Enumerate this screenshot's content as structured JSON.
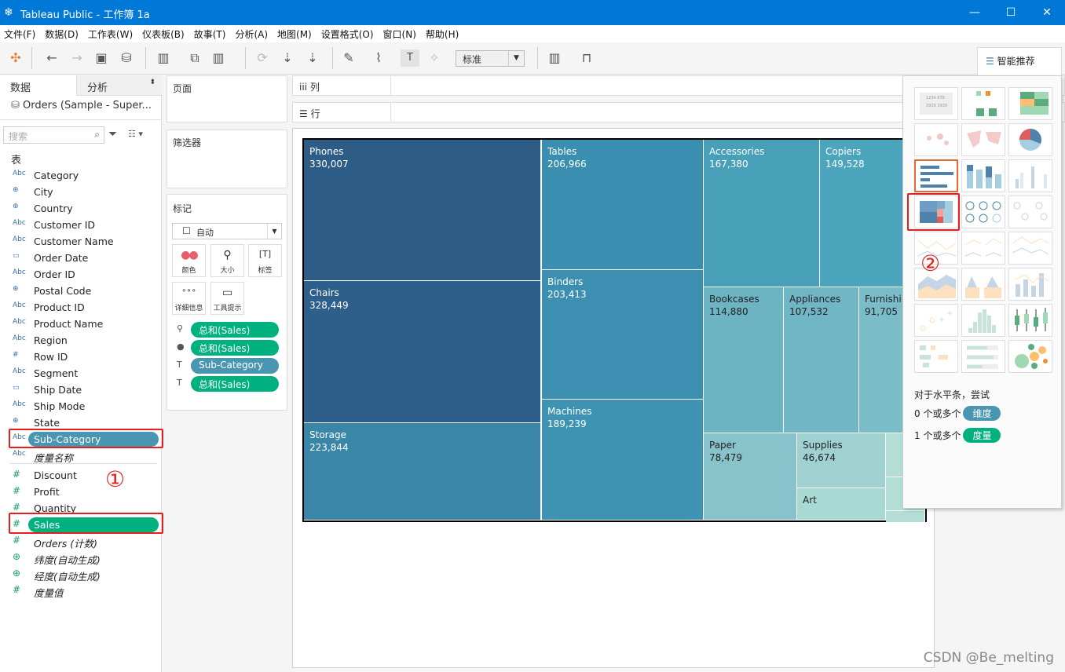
{
  "window": {
    "title": "Tableau Public - 工作簿 1a",
    "controls": [
      "minimize",
      "maximize",
      "close"
    ]
  },
  "menu": [
    "文件(F)",
    "数据(D)",
    "工作表(W)",
    "仪表板(B)",
    "故事(T)",
    "分析(A)",
    "地图(M)",
    "设置格式(O)",
    "窗口(N)",
    "帮助(H)"
  ],
  "toolbar": {
    "fit": "标准",
    "showme": "智能推荐"
  },
  "left": {
    "tabs": [
      "数据",
      "分析"
    ],
    "datasource": "Orders (Sample - Super...",
    "search_placeholder": "搜索",
    "section": "表",
    "dimensions": [
      {
        "type": "Abc",
        "name": "Category"
      },
      {
        "type": "globe",
        "name": "City"
      },
      {
        "type": "globe",
        "name": "Country"
      },
      {
        "type": "Abc",
        "name": "Customer ID"
      },
      {
        "type": "Abc",
        "name": "Customer Name"
      },
      {
        "type": "date",
        "name": "Order Date"
      },
      {
        "type": "Abc",
        "name": "Order ID"
      },
      {
        "type": "globe",
        "name": "Postal Code"
      },
      {
        "type": "Abc",
        "name": "Product ID"
      },
      {
        "type": "Abc",
        "name": "Product Name"
      },
      {
        "type": "Abc",
        "name": "Region"
      },
      {
        "type": "#",
        "name": "Row ID"
      },
      {
        "type": "Abc",
        "name": "Segment"
      },
      {
        "type": "date",
        "name": "Ship Date"
      },
      {
        "type": "Abc",
        "name": "Ship Mode"
      },
      {
        "type": "globe",
        "name": "State"
      },
      {
        "type": "Abc",
        "name": "Sub-Category"
      },
      {
        "type": "Abc",
        "name": "度量名称"
      }
    ],
    "measures": [
      {
        "type": "#",
        "name": "Discount"
      },
      {
        "type": "#",
        "name": "Profit"
      },
      {
        "type": "#",
        "name": "Quantity"
      },
      {
        "type": "#",
        "name": "Sales"
      },
      {
        "type": "#",
        "name": "Orders (计数)"
      },
      {
        "type": "globe",
        "name": "纬度(自动生成)"
      },
      {
        "type": "globe",
        "name": "经度(自动生成)"
      },
      {
        "type": "#",
        "name": "度量值"
      }
    ]
  },
  "shelves": {
    "pages": "页面",
    "filters": "筛选器",
    "marks": "标记",
    "mark_type": "自动",
    "columns": "列",
    "rows": "行",
    "mark_buttons": [
      "颜色",
      "大小",
      "标签",
      "详细信息",
      "工具提示"
    ],
    "pills": [
      {
        "icon": "size",
        "label": "总和(Sales)",
        "kind": "measure"
      },
      {
        "icon": "color",
        "label": "总和(Sales)",
        "kind": "measure"
      },
      {
        "icon": "label",
        "label": "Sub-Category",
        "kind": "dimension"
      },
      {
        "icon": "label",
        "label": "总和(Sales)",
        "kind": "measure"
      }
    ]
  },
  "chart_data": {
    "type": "treemap",
    "items": [
      {
        "name": "Phones",
        "value": 330007
      },
      {
        "name": "Chairs",
        "value": 328449
      },
      {
        "name": "Storage",
        "value": 223844
      },
      {
        "name": "Tables",
        "value": 206966
      },
      {
        "name": "Binders",
        "value": 203413
      },
      {
        "name": "Machines",
        "value": 189239
      },
      {
        "name": "Accessories",
        "value": 167380
      },
      {
        "name": "Copiers",
        "value": 149528
      },
      {
        "name": "Bookcases",
        "value": 114880
      },
      {
        "name": "Appliances",
        "value": 107532
      },
      {
        "name": "Furnishi",
        "value": 91705
      },
      {
        "name": "Paper",
        "value": 78479
      },
      {
        "name": "Supplies",
        "value": 46674
      },
      {
        "name": "Art",
        "value": null
      }
    ],
    "color_range": [
      "#2d5c87",
      "#b2ded6"
    ]
  },
  "showme": {
    "charts": [
      "text-table",
      "heat-map",
      "highlight-table",
      "symbol-map",
      "filled-map",
      "pie-chart",
      "horizontal-bars",
      "stacked-bars",
      "side-by-side-bars",
      "treemap",
      "circle-views",
      "side-by-side-circles",
      "lines-continuous",
      "lines-discrete",
      "dual-lines",
      "area-continuous",
      "area-discrete",
      "dual-combination",
      "scatter-plot",
      "histogram",
      "box-whisker",
      "gantt",
      "bullet-graph",
      "packed-bubbles"
    ],
    "selected": "treemap",
    "hint_title": "对于水平条，尝试",
    "hint_dim_prefix": "0 个或多个",
    "hint_dim": "维度",
    "hint_meas_prefix": "1 个或多个",
    "hint_meas": "度量"
  },
  "annotations": {
    "step1": "①",
    "step2": "②"
  },
  "watermark": "CSDN @Be_melting"
}
